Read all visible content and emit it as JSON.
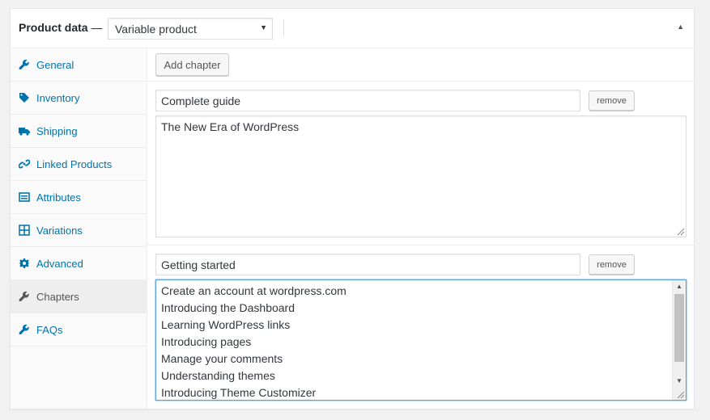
{
  "header": {
    "title": "Product data",
    "dash": "—",
    "product_type": "Variable product"
  },
  "sidebar": {
    "items": [
      {
        "label": "General",
        "icon": "wrench-icon"
      },
      {
        "label": "Inventory",
        "icon": "tag-icon"
      },
      {
        "label": "Shipping",
        "icon": "truck-icon"
      },
      {
        "label": "Linked Products",
        "icon": "link-icon"
      },
      {
        "label": "Attributes",
        "icon": "list-icon"
      },
      {
        "label": "Variations",
        "icon": "grid-icon"
      },
      {
        "label": "Advanced",
        "icon": "gear-icon"
      },
      {
        "label": "Chapters",
        "icon": "wrench-icon"
      },
      {
        "label": "FAQs",
        "icon": "wrench-icon"
      }
    ],
    "active": "Chapters"
  },
  "panel": {
    "add_label": "Add chapter",
    "chapters": [
      {
        "title": "Complete guide",
        "remove_label": "remove",
        "lines": [
          "The New Era of WordPress"
        ]
      },
      {
        "title": "Getting started",
        "remove_label": "remove",
        "lines": [
          "Create an account at wordpress.com",
          "Introducing the Dashboard",
          "Learning WordPress links",
          "Introducing pages",
          "Manage your comments",
          "Understanding themes",
          "Introducing Theme Customizer"
        ]
      }
    ]
  },
  "colors": {
    "link": "#0073aa",
    "active_tab_bg": "#eeeeee",
    "focus_border": "#5b9dd9"
  }
}
